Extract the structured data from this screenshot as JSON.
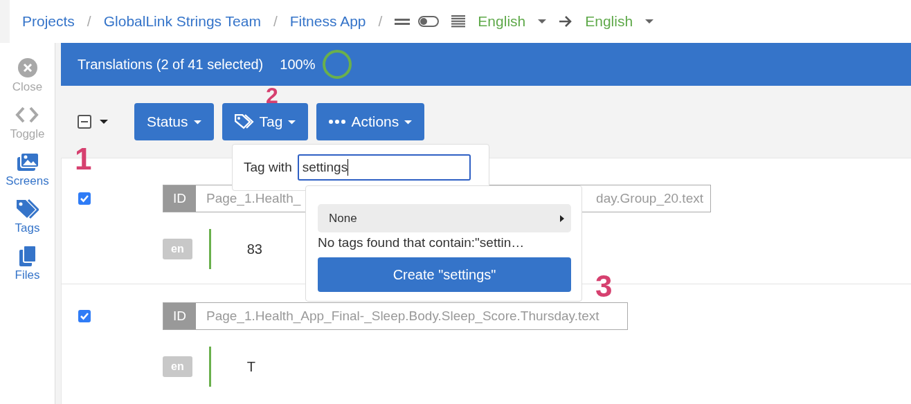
{
  "breadcrumb": {
    "items": [
      "Projects",
      "GlobalLink Strings Team",
      "Fitness App"
    ],
    "separator": "/",
    "view_toggle": {
      "on": false
    },
    "source_language": "English",
    "target_language": "English"
  },
  "sidebar": {
    "items": [
      {
        "label": "Close",
        "kind": "close",
        "disabled": true
      },
      {
        "label": "Toggle",
        "kind": "code",
        "disabled": true
      },
      {
        "label": "Screens",
        "kind": "images",
        "disabled": false
      },
      {
        "label": "Tags",
        "kind": "tags",
        "disabled": false
      },
      {
        "label": "Files",
        "kind": "files",
        "disabled": false
      }
    ]
  },
  "header": {
    "title": "Translations (2 of 41 selected)",
    "percent": "100%",
    "level": 1.0
  },
  "toolbar": {
    "select_all": {
      "indeterminate": true
    },
    "buttons": [
      {
        "label": "Status",
        "kind": "plain"
      },
      {
        "label": "Tag",
        "kind": "tag"
      },
      {
        "label": "Actions",
        "kind": "dots"
      }
    ]
  },
  "rows": [
    {
      "checked": true,
      "id_label": "ID",
      "id_start": "Page_1.Health_",
      "id_end": "day.Group_20.text",
      "lang": "en",
      "text": "83"
    },
    {
      "checked": true,
      "id_label": "ID",
      "id_start": "Page_1.Health_App_Final-_Sleep.Body.Sleep_Score.Thursday.text",
      "lang": "en",
      "text": "T"
    }
  ],
  "tag_popup": {
    "label": "Tag with",
    "value": "settings"
  },
  "tag_results": {
    "option": "None",
    "message": "No tags found that contain:\"settin…",
    "create_button": "Create \"settings\""
  },
  "annotations": [
    "1",
    "2",
    "3"
  ]
}
